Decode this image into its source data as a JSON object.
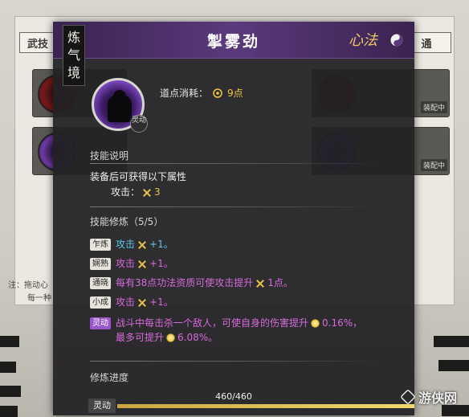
{
  "background": {
    "tab_left": "武技",
    "tab_right": "通",
    "note_line1": "注：拖动心",
    "note_line2": "每一种",
    "card_tag": "装配中"
  },
  "dialog": {
    "realm": [
      "炼",
      "气",
      "境"
    ],
    "title": "掣雾劲",
    "type_badge": "心法",
    "skill_tag": "灵动",
    "cost_label": "道点消耗：",
    "cost_value": "9点",
    "description_title": "技能说明",
    "description_text": "装备后可获得以下属性",
    "attack_label": "攻击：",
    "attack_value": "3",
    "cultivation_title": "技能修炼（5/5）",
    "tiers": [
      {
        "badge": "乍炼",
        "style": "cyan",
        "text": "攻击",
        "value": "+1。"
      },
      {
        "badge": "娴熟",
        "style": "purple-text",
        "text": "攻击",
        "value": "+1。"
      },
      {
        "badge": "通晓",
        "style": "purple-text",
        "text": "每有38点功法资质可使攻击提升",
        "value": "1点。"
      },
      {
        "badge": "小成",
        "style": "purple-text",
        "text": "攻击",
        "value": "+1。"
      },
      {
        "badge": "灵动",
        "style": "purple-badge",
        "line1": "战斗中每击杀一个敌人，可使自身的伤害提升",
        "value1": "0.16%，",
        "line2": "最多可提升",
        "value2": "6.08%。"
      }
    ],
    "progress_label": "修炼进度",
    "progress_text": "460/460",
    "progress_current": 460,
    "progress_max": 460,
    "bottom_tag": "灵动"
  },
  "watermark": "游侠网",
  "colors": {
    "accent_gold": "#e8c64a",
    "purple_text": "#d66bdc",
    "cyan_text": "#5fc7e8",
    "header_purple": "#5a3a7c"
  }
}
